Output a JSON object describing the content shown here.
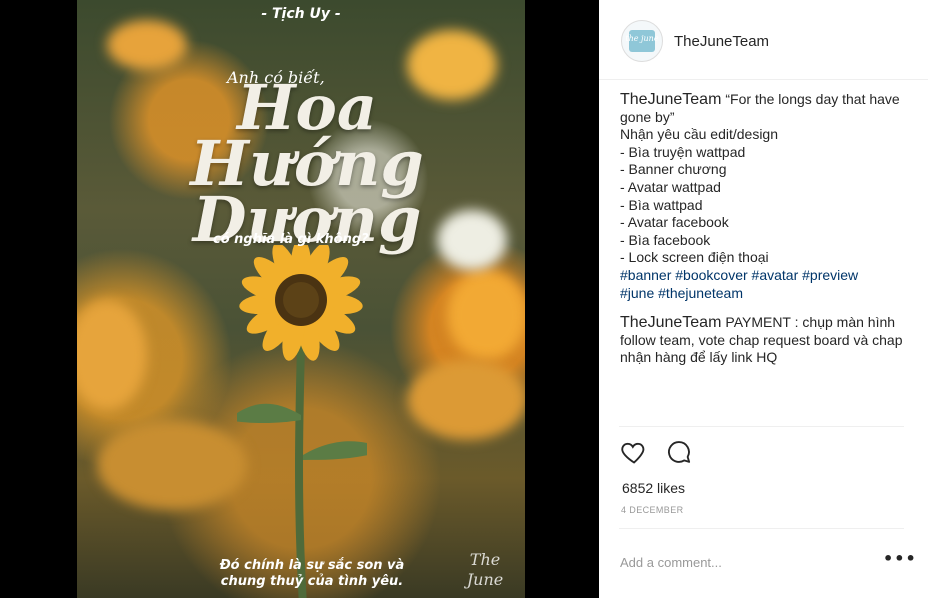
{
  "poster": {
    "author": "- Tịch Uy -",
    "lead": "Anh có biết,",
    "title_lines": [
      "Hoa",
      "Hướng",
      "Dương"
    ],
    "subtitle": "có nghĩa là gì không?",
    "bottom_line1": "Đó chính là sự sắc son và",
    "bottom_line2": "chung thuỷ của tình yêu.",
    "logo": "The June"
  },
  "header": {
    "username": "TheJuneTeam",
    "avatar_text": "the june"
  },
  "caption": {
    "author": "TheJuneTeam",
    "text": "“For the longs day that have gone by”",
    "lines": [
      "Nhận yêu cầu edit/design",
      "- Bìa truyện wattpad",
      "- Banner chương",
      "- Avatar wattpad",
      "- Bìa wattpad",
      "- Avatar facebook",
      "- Bìa facebook",
      "- Lock screen điện thoại"
    ],
    "hashtags_line1": "#banner #bookcover #avatar #preview",
    "hashtags_line2": "#june #thejuneteam"
  },
  "comment": {
    "author": "TheJuneTeam",
    "text": "PAYMENT : chụp màn hình follow team, vote chap request board và chap nhận hàng để lấy link HQ"
  },
  "actions": {
    "like_icon": "heart-icon",
    "comment_icon": "comment-icon"
  },
  "likes": "6852 likes",
  "date": "4 December",
  "add_comment": {
    "placeholder": "Add a comment..."
  },
  "more_label": "•••",
  "colors": {
    "hashtag": "#003569",
    "text": "#262626",
    "muted": "#999999",
    "divider": "#efefef"
  }
}
